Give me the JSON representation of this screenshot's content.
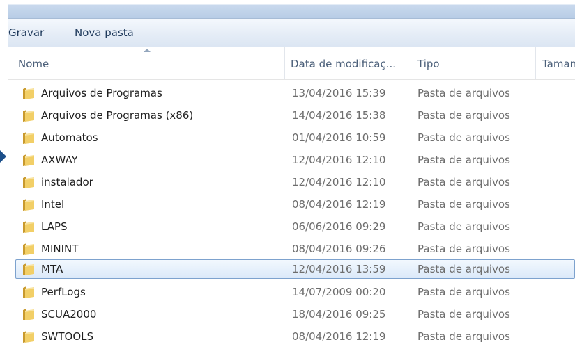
{
  "toolbar": {
    "burn_label": "Gravar",
    "new_folder_label": "Nova pasta"
  },
  "columns": {
    "name": "Nome",
    "date": "Data de modificaç...",
    "type": "Tipo",
    "size": "Tamanho"
  },
  "files": [
    {
      "name": "Arquivos de Programas",
      "date": "13/04/2016 15:39",
      "type": "Pasta de arquivos"
    },
    {
      "name": "Arquivos de Programas (x86)",
      "date": "14/04/2016 15:38",
      "type": "Pasta de arquivos"
    },
    {
      "name": "Automatos",
      "date": "01/04/2016 10:59",
      "type": "Pasta de arquivos"
    },
    {
      "name": "AXWAY",
      "date": "12/04/2016 12:10",
      "type": "Pasta de arquivos"
    },
    {
      "name": "instalador",
      "date": "12/04/2016 12:10",
      "type": "Pasta de arquivos"
    },
    {
      "name": "Intel",
      "date": "08/04/2016 12:19",
      "type": "Pasta de arquivos"
    },
    {
      "name": "LAPS",
      "date": "06/06/2016 09:29",
      "type": "Pasta de arquivos"
    },
    {
      "name": "MININT",
      "date": "08/04/2016 09:26",
      "type": "Pasta de arquivos"
    },
    {
      "name": "MTA",
      "date": "12/04/2016 13:59",
      "type": "Pasta de arquivos",
      "selected": true
    },
    {
      "name": "PerfLogs",
      "date": "14/07/2009 00:20",
      "type": "Pasta de arquivos"
    },
    {
      "name": "SCUA2000",
      "date": "18/04/2016 09:25",
      "type": "Pasta de arquivos"
    },
    {
      "name": "SWTOOLS",
      "date": "08/04/2016 12:19",
      "type": "Pasta de arquivos"
    }
  ],
  "colors": {
    "selection_border": "#7da2ce",
    "header_text": "#4c607a",
    "folder": "#e8c15a"
  },
  "icons": {
    "folder": "folder-icon",
    "sort": "sort-ascending-icon",
    "nav": "nav-arrow-icon"
  }
}
